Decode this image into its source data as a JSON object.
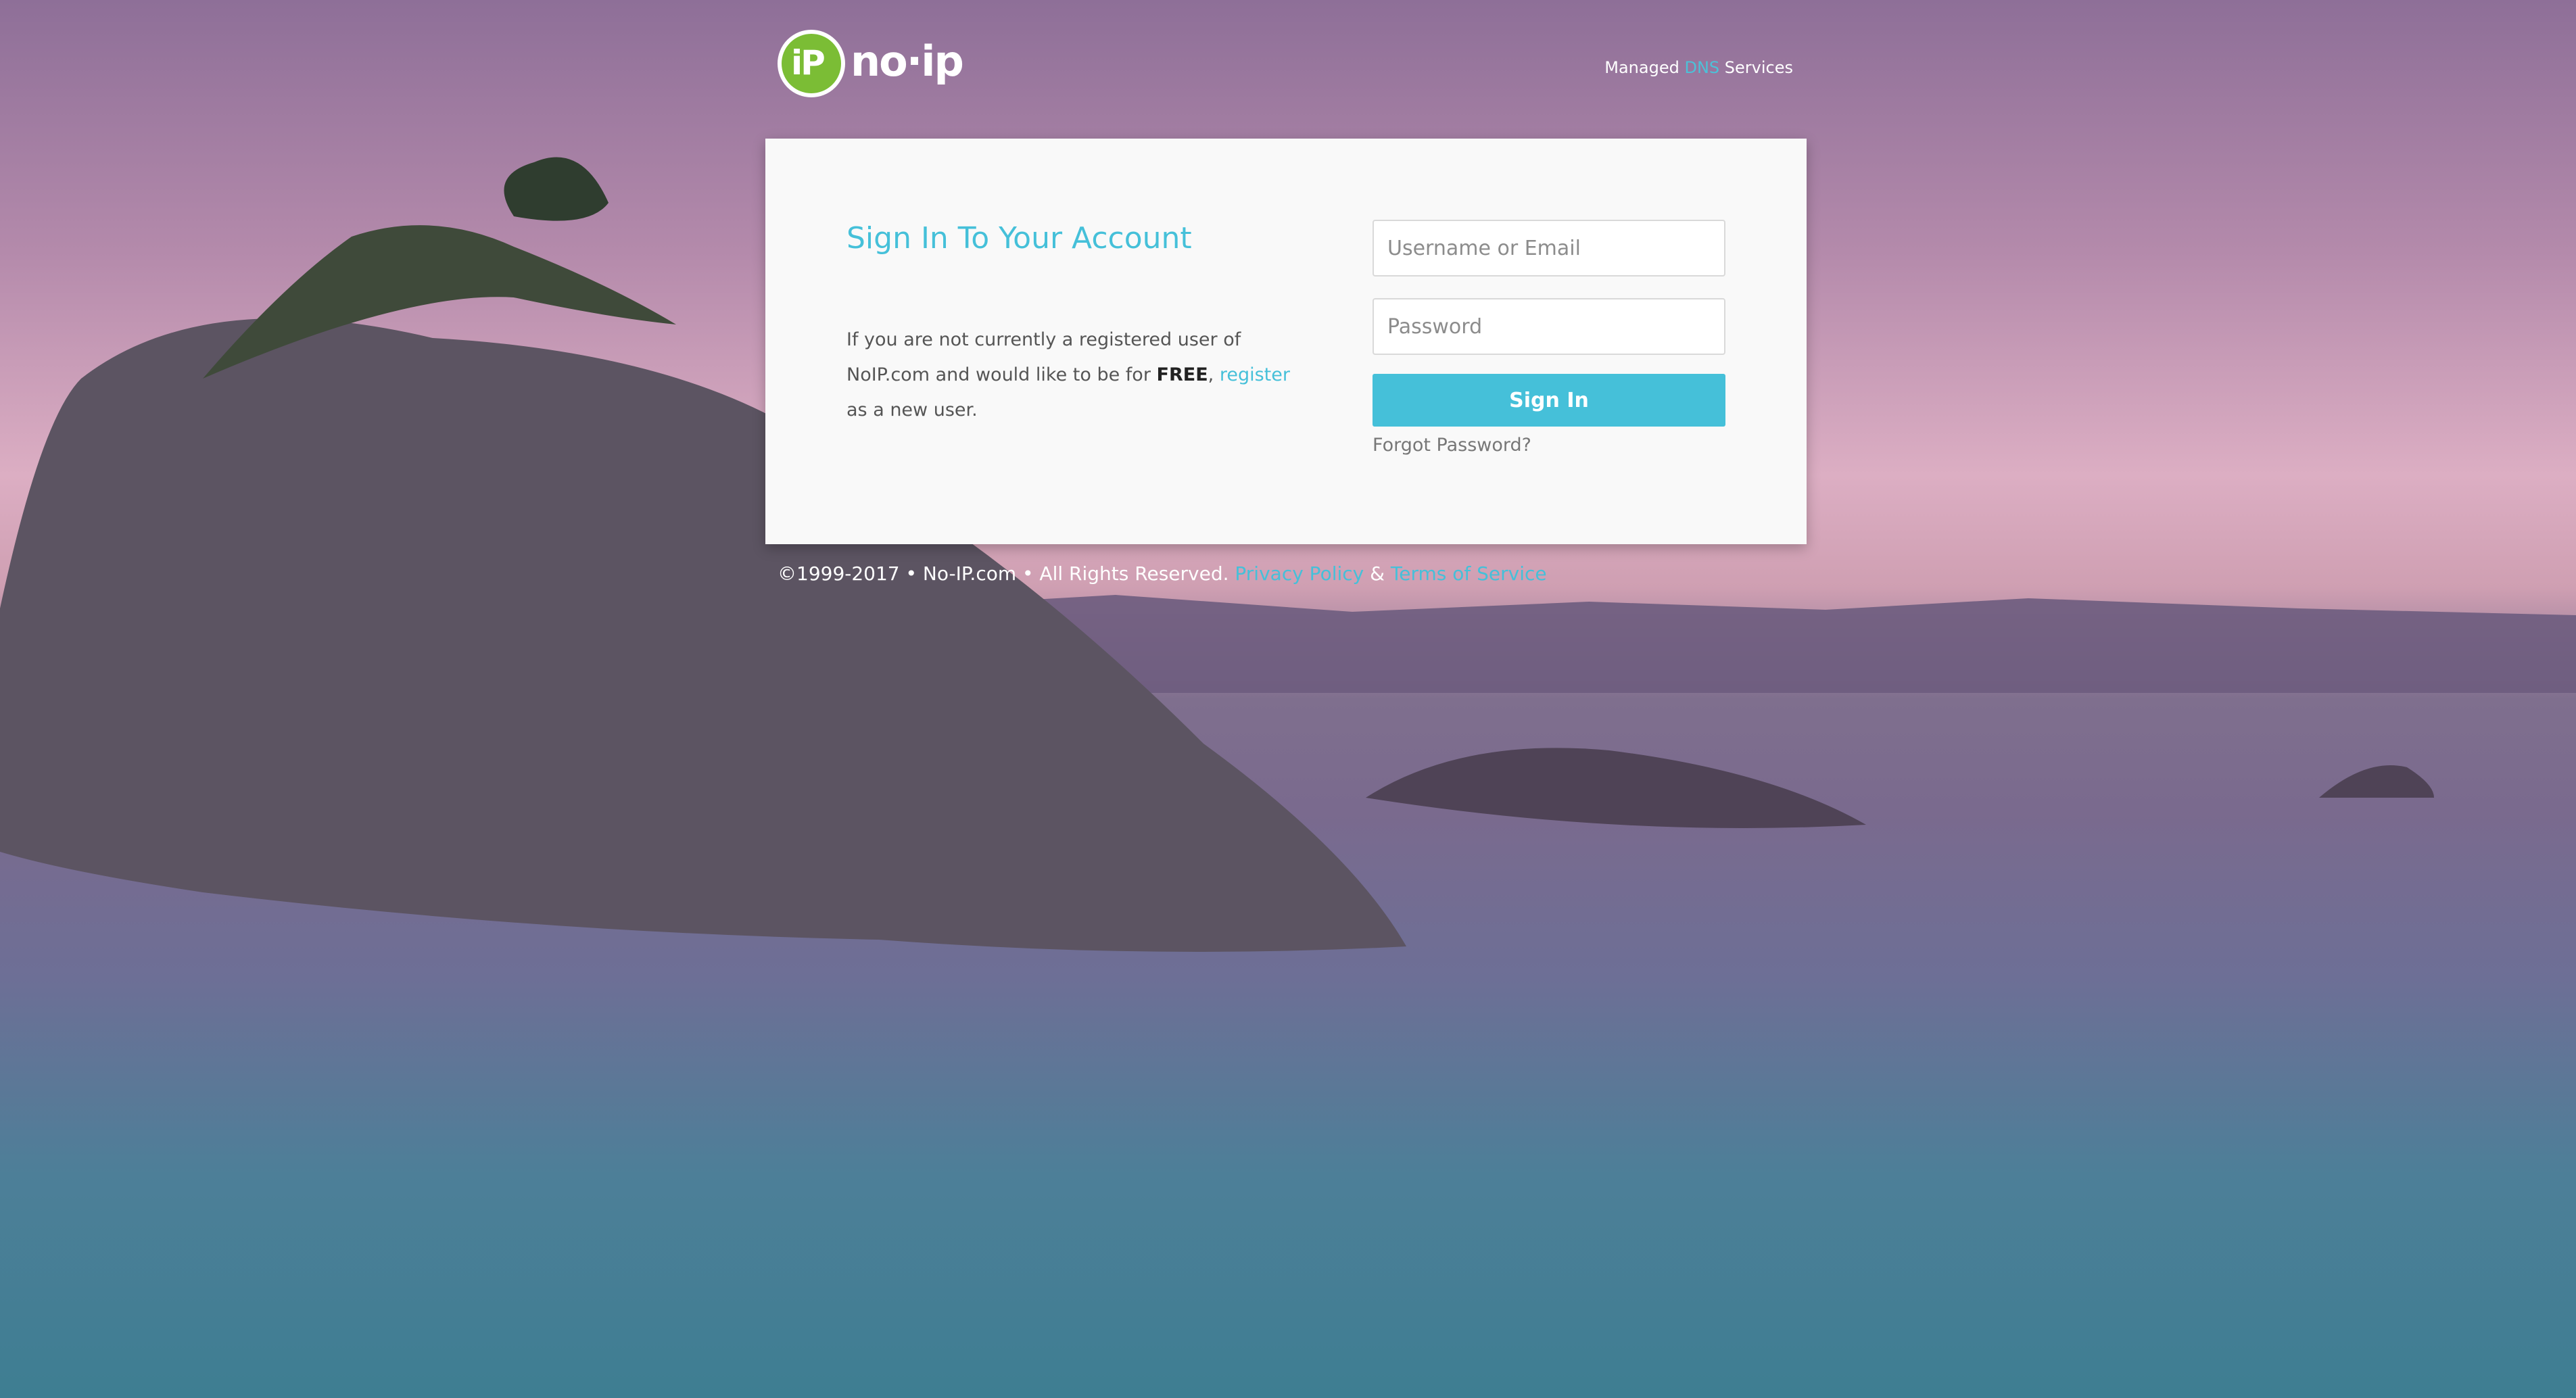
{
  "brand": {
    "logo_badge": "iP",
    "logo_text": "no·ip",
    "tagline_prefix": "Managed",
    "tagline_accent": "DNS",
    "tagline_suffix": "Services"
  },
  "signin": {
    "title": "Sign In To Your Account",
    "intro_before_free": "If you are not currently a registered user of NoIP.com and would like to be for",
    "free": "FREE",
    "intro_comma": ",",
    "register_link": "register",
    "intro_after": "as a new user.",
    "username_placeholder": "Username or Email",
    "password_placeholder": "Password",
    "button": "Sign In",
    "forgot": "Forgot Password?"
  },
  "footer": {
    "copyright": "©1999-2017 • No-IP.com • All Rights Reserved.",
    "privacy": "Privacy Policy",
    "ampersand": "&",
    "terms": "Terms of Service"
  },
  "colors": {
    "accent": "#45c0d9",
    "logo_green": "#7bbd35",
    "card": "#f9f9f9"
  },
  "icons": {
    "logo": "no-ip-logo-icon"
  }
}
